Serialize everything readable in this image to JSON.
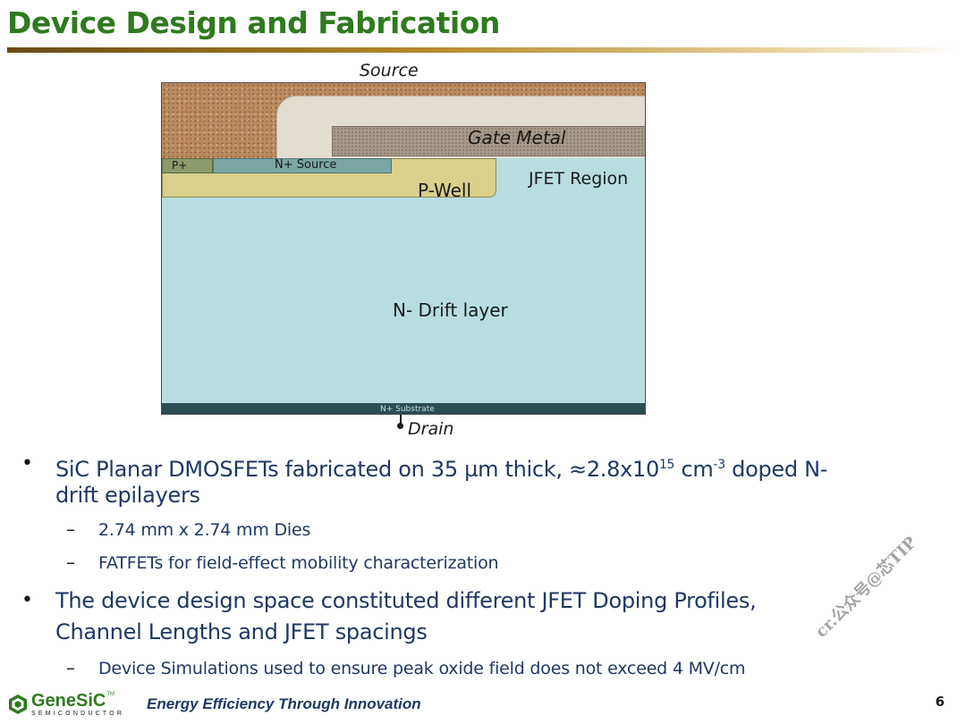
{
  "slide": {
    "title": "Device Design and Fabrication",
    "page_number": "6"
  },
  "diagram": {
    "source_label": "Source",
    "drain_label": "Drain",
    "gate_metal_label": "Gate Metal",
    "p_plus_label": "P+",
    "n_source_label": "N+ Source",
    "p_well_label": "P-Well",
    "jfet_label": "JFET Region",
    "drift_label": "N- Drift layer",
    "substrate_label": "N+ Substrate",
    "colors": {
      "source_metal": "#b98a5e",
      "oxide": "#e3dcd0",
      "gate_metal": "#a79a8c",
      "p_plus": "#8c9b6a",
      "n_source": "#7aa7a4",
      "p_well": "#d9d08c",
      "drift": "#b8dde0",
      "substrate": "#2b4d54"
    }
  },
  "bullets": [
    {
      "text_line1": "SiC Planar DMOSFETs fabricated on 35 µm thick, ≈2.8x10",
      "sup1": "15",
      "mid": " cm",
      "sup2": "-3",
      "end": " doped N-",
      "text_line2": "drift epilayers",
      "sub": [
        "2.74 mm x 2.74 mm Dies",
        "FATFETs for field-effect mobility characterization"
      ]
    },
    {
      "text_line1": "The device design space constituted different JFET Doping Profiles,",
      "text_line2": "Channel Lengths and JFET spacings",
      "sub": [
        "Device Simulations used to ensure peak oxide field does not exceed 4 MV/cm"
      ]
    }
  ],
  "footer": {
    "logo_text": "GeneSiC",
    "logo_tm": "TM",
    "logo_sub": "SEMICONDUCTOR",
    "tagline": "Energy Efficiency Through Innovation"
  },
  "watermark": "cr.公众号@芯TIP"
}
